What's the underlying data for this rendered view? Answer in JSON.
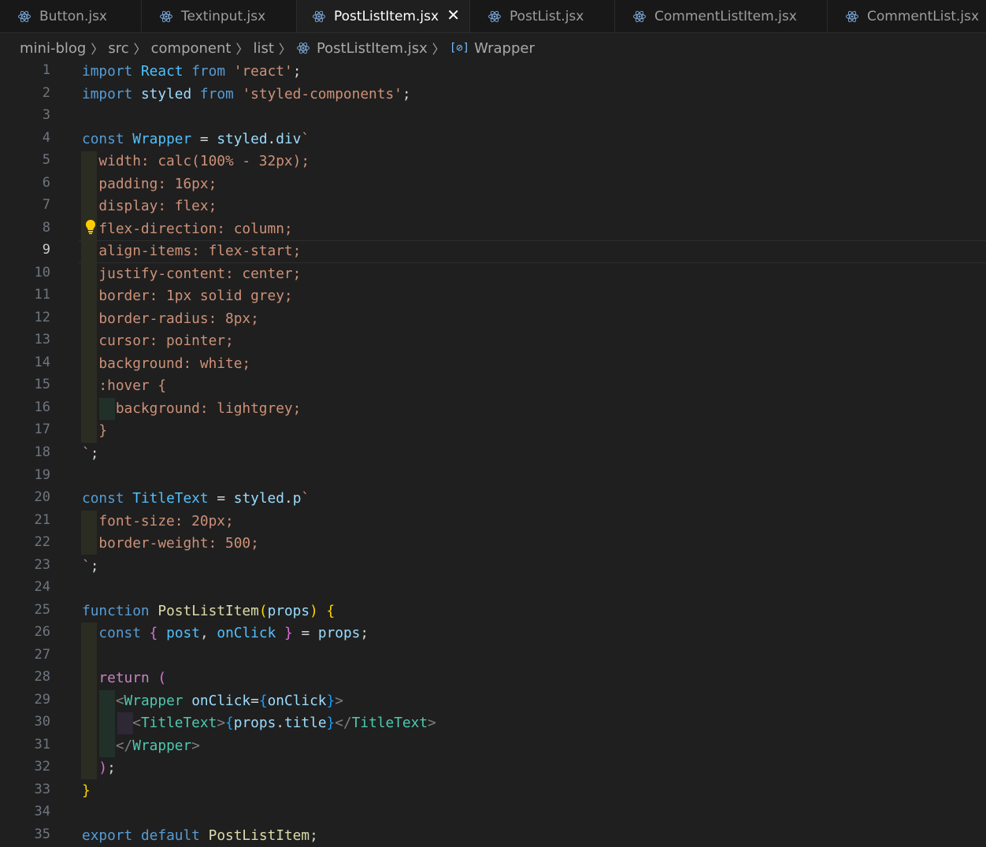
{
  "tabs": [
    {
      "label": "Button.jsx",
      "active": false
    },
    {
      "label": "Textinput.jsx",
      "active": false
    },
    {
      "label": "PostListItem.jsx",
      "active": true
    },
    {
      "label": "PostList.jsx",
      "active": false
    },
    {
      "label": "CommentListItem.jsx",
      "active": false
    },
    {
      "label": "CommentList.jsx",
      "active": false
    }
  ],
  "breadcrumb": {
    "items": [
      "mini-blog",
      "src",
      "component",
      "list",
      "PostListItem.jsx",
      "Wrapper"
    ]
  },
  "editor": {
    "current_line": 9,
    "line_numbers": [
      "1",
      "2",
      "3",
      "4",
      "5",
      "6",
      "7",
      "8",
      "9",
      "10",
      "11",
      "12",
      "13",
      "14",
      "15",
      "16",
      "17",
      "18",
      "19",
      "20",
      "21",
      "22",
      "23",
      "24",
      "25",
      "26",
      "27",
      "28",
      "29",
      "30",
      "31",
      "32",
      "33",
      "34",
      "35"
    ],
    "lines": [
      [
        [
          "kw",
          "import"
        ],
        [
          "pun",
          " "
        ],
        [
          "id",
          "React"
        ],
        [
          "pun",
          " "
        ],
        [
          "kw",
          "from"
        ],
        [
          "pun",
          " "
        ],
        [
          "str",
          "'react'"
        ],
        [
          "pun",
          ";"
        ]
      ],
      [
        [
          "kw",
          "import"
        ],
        [
          "pun",
          " "
        ],
        [
          "var",
          "styled"
        ],
        [
          "pun",
          " "
        ],
        [
          "kw",
          "from"
        ],
        [
          "pun",
          " "
        ],
        [
          "str",
          "'styled-components'"
        ],
        [
          "pun",
          ";"
        ]
      ],
      [],
      [
        [
          "kw",
          "const"
        ],
        [
          "pun",
          " "
        ],
        [
          "id",
          "Wrapper"
        ],
        [
          "pun",
          " = "
        ],
        [
          "var",
          "styled"
        ],
        [
          "pun",
          "."
        ],
        [
          "var",
          "div"
        ],
        [
          "str",
          "`"
        ]
      ],
      [
        [
          "str",
          "  width: calc(100% - 32px);"
        ]
      ],
      [
        [
          "str",
          "  padding: 16px;"
        ]
      ],
      [
        [
          "str",
          "  display: flex;"
        ]
      ],
      [
        [
          "str",
          "  flex-direction: column;"
        ]
      ],
      [
        [
          "str",
          "  align-items: flex-start;"
        ]
      ],
      [
        [
          "str",
          "  justify-content: center;"
        ]
      ],
      [
        [
          "str",
          "  border: 1px solid grey;"
        ]
      ],
      [
        [
          "str",
          "  border-radius: 8px;"
        ]
      ],
      [
        [
          "str",
          "  cursor: pointer;"
        ]
      ],
      [
        [
          "str",
          "  background: white;"
        ]
      ],
      [
        [
          "str",
          "  :hover {"
        ]
      ],
      [
        [
          "str",
          "    background: lightgrey;"
        ]
      ],
      [
        [
          "str",
          "  }"
        ]
      ],
      [
        [
          "str",
          "`"
        ],
        [
          "pun",
          ";"
        ]
      ],
      [],
      [
        [
          "kw",
          "const"
        ],
        [
          "pun",
          " "
        ],
        [
          "id",
          "TitleText"
        ],
        [
          "pun",
          " = "
        ],
        [
          "var",
          "styled"
        ],
        [
          "pun",
          "."
        ],
        [
          "var",
          "p"
        ],
        [
          "str",
          "`"
        ]
      ],
      [
        [
          "str",
          "  font-size: 20px;"
        ]
      ],
      [
        [
          "str",
          "  border-weight: 500;"
        ]
      ],
      [
        [
          "str",
          "`"
        ],
        [
          "pun",
          ";"
        ]
      ],
      [],
      [
        [
          "kw",
          "function"
        ],
        [
          "pun",
          " "
        ],
        [
          "fn",
          "PostListItem"
        ],
        [
          "p1",
          "("
        ],
        [
          "var",
          "props"
        ],
        [
          "p1",
          ")"
        ],
        [
          "pun",
          " "
        ],
        [
          "p1",
          "{"
        ]
      ],
      [
        [
          "pun",
          "  "
        ],
        [
          "kw",
          "const"
        ],
        [
          "pun",
          " "
        ],
        [
          "p2",
          "{"
        ],
        [
          "pun",
          " "
        ],
        [
          "id",
          "post"
        ],
        [
          "pun",
          ", "
        ],
        [
          "id",
          "onClick"
        ],
        [
          "pun",
          " "
        ],
        [
          "p2",
          "}"
        ],
        [
          "pun",
          " = "
        ],
        [
          "var",
          "props"
        ],
        [
          "pun",
          ";"
        ]
      ],
      [],
      [
        [
          "pun",
          "  "
        ],
        [
          "ctrl",
          "return"
        ],
        [
          "pun",
          " "
        ],
        [
          "p2",
          "("
        ]
      ],
      [
        [
          "pun",
          "    "
        ],
        [
          "tagp",
          "<"
        ],
        [
          "tag",
          "Wrapper"
        ],
        [
          "pun",
          " "
        ],
        [
          "attr",
          "onClick"
        ],
        [
          "pun",
          "="
        ],
        [
          "p3",
          "{"
        ],
        [
          "var",
          "onClick"
        ],
        [
          "p3",
          "}"
        ],
        [
          "tagp",
          ">"
        ]
      ],
      [
        [
          "pun",
          "      "
        ],
        [
          "tagp",
          "<"
        ],
        [
          "tag",
          "TitleText"
        ],
        [
          "tagp",
          ">"
        ],
        [
          "p3",
          "{"
        ],
        [
          "var",
          "props"
        ],
        [
          "pun",
          "."
        ],
        [
          "var",
          "title"
        ],
        [
          "p3",
          "}"
        ],
        [
          "tagp",
          "</"
        ],
        [
          "tag",
          "TitleText"
        ],
        [
          "tagp",
          ">"
        ]
      ],
      [
        [
          "pun",
          "    "
        ],
        [
          "tagp",
          "</"
        ],
        [
          "tag",
          "Wrapper"
        ],
        [
          "tagp",
          ">"
        ]
      ],
      [
        [
          "pun",
          "  "
        ],
        [
          "p2",
          ")"
        ],
        [
          "pun",
          ";"
        ]
      ],
      [
        [
          "p1",
          "}"
        ]
      ],
      [],
      [
        [
          "kw",
          "export"
        ],
        [
          "pun",
          " "
        ],
        [
          "kw",
          "default"
        ],
        [
          "pun",
          " "
        ],
        [
          "fn",
          "PostListItem"
        ],
        [
          "pun",
          ";"
        ]
      ]
    ]
  }
}
